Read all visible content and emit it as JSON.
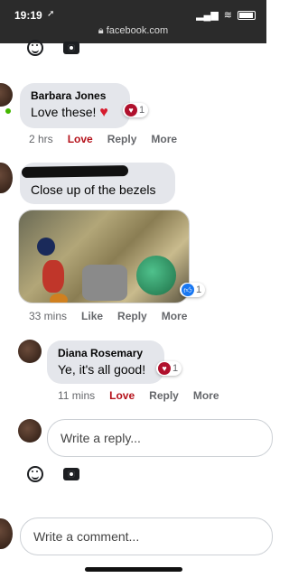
{
  "status_bar": {
    "time": "19:19",
    "location_glyph": "➚",
    "url": "facebook.com",
    "signal": "▂▄▆",
    "wifi": "≋"
  },
  "comments": [
    {
      "author": "Barbara Jones",
      "text": "Love these!",
      "inline_emoji": "♥",
      "reaction_count": "1",
      "time": "2 hrs",
      "reacted_label": "Love",
      "reply_label": "Reply",
      "more_label": "More"
    },
    {
      "author": "",
      "text": "Close up of the bezels",
      "reaction_count": "1",
      "time": "33 mins",
      "like_label": "Like",
      "reply_label": "Reply",
      "more_label": "More"
    }
  ],
  "reply": {
    "author": "Diana Rosemary",
    "text": "Ye, it's all good!",
    "reaction_count": "1",
    "time": "11 mins",
    "reacted_label": "Love",
    "reply_label": "Reply",
    "more_label": "More"
  },
  "reply_input": {
    "placeholder": "Write a reply..."
  },
  "comment_input": {
    "placeholder": "Write a comment..."
  },
  "colors": {
    "love": "#b5121b",
    "like": "#1877f2",
    "bubble": "#e4e6eb",
    "online": "#44b700"
  },
  "icons": {
    "emoji": "smiley-icon",
    "camera": "camera-icon",
    "love_reaction": "love-reaction-icon",
    "like_reaction": "like-reaction-icon",
    "heart": "heart-icon"
  }
}
